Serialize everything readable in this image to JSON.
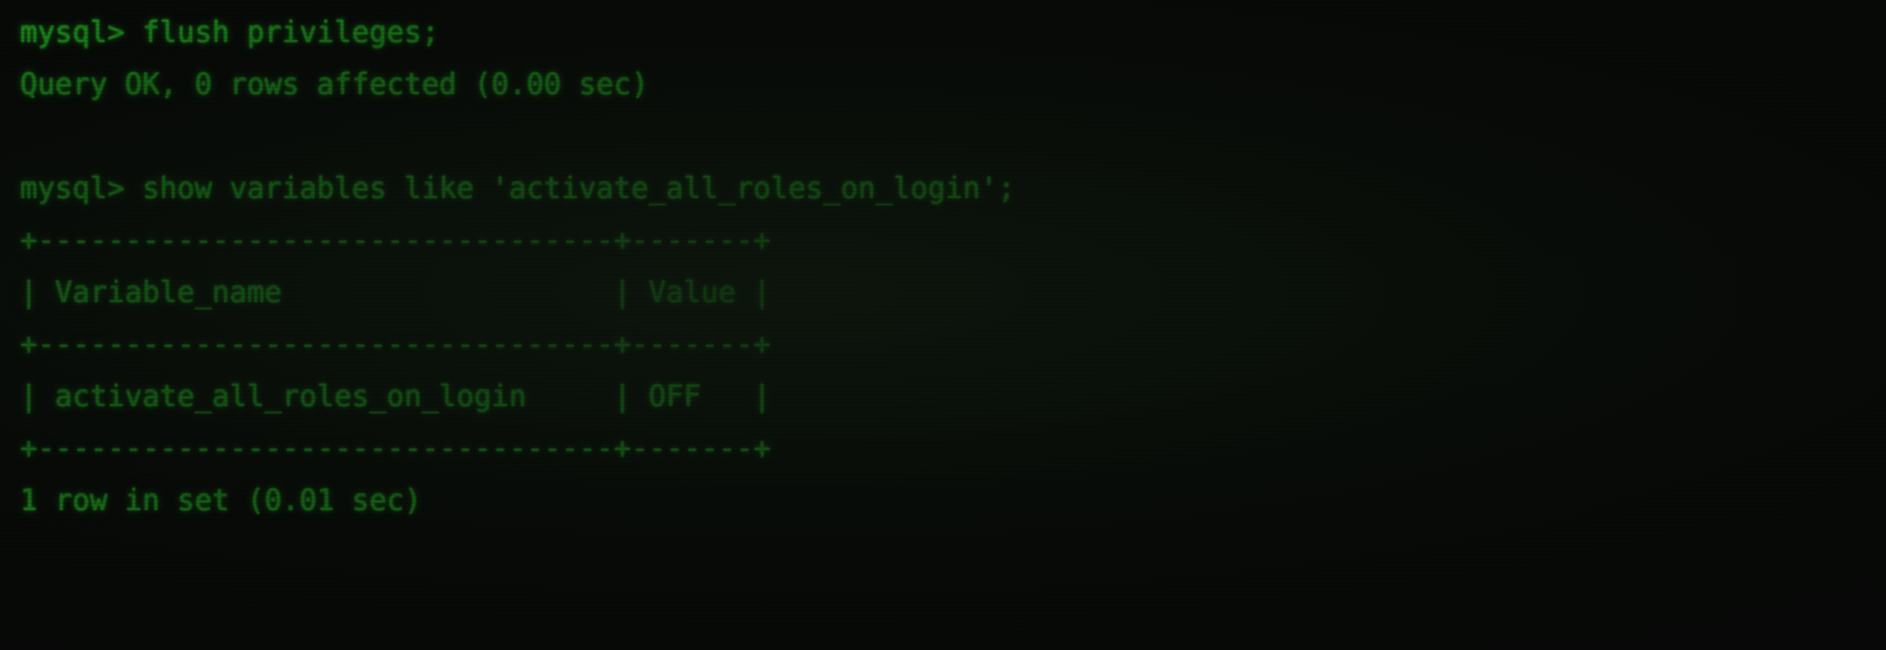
{
  "terminal": {
    "type": "mysql-client-console",
    "colors": {
      "background": "#070807",
      "foreground": "#24c924",
      "glow": "#3ceb3c"
    },
    "prompt": "mysql>",
    "lines": [
      {
        "id": "cmd-flush-privileges",
        "kind": "command",
        "text": "mysql> flush privileges;"
      },
      {
        "id": "result-flush-privileges",
        "kind": "result",
        "text": "Query OK, 0 rows affected (0.00 sec)"
      },
      {
        "id": "blank-1",
        "kind": "blank",
        "text": ""
      },
      {
        "id": "cmd-show-variables",
        "kind": "command",
        "text": "mysql> show variables like 'activate_all_roles_on_login';"
      },
      {
        "id": "table-border-top",
        "kind": "table-border",
        "text": "+---------------------------------+-------+"
      },
      {
        "id": "table-header-row",
        "kind": "table-header",
        "text": "| Variable_name                   | Value |"
      },
      {
        "id": "table-border-middle",
        "kind": "table-border",
        "text": "+---------------------------------+-------+"
      },
      {
        "id": "table-data-row-1",
        "kind": "table-row",
        "text": "| activate_all_roles_on_login     | OFF   |"
      },
      {
        "id": "table-border-bottom",
        "kind": "table-border",
        "text": "+---------------------------------+-------+"
      },
      {
        "id": "result-row-count",
        "kind": "result",
        "text": "1 row in set (0.01 sec)"
      }
    ],
    "commands": [
      {
        "text": "flush privileges;",
        "status": "Query OK",
        "rows_affected": 0,
        "duration": "0.00 sec"
      },
      {
        "text": "show variables like 'activate_all_roles_on_login';",
        "rows_returned": 1,
        "duration": "0.01 sec"
      }
    ],
    "result_table": {
      "columns": [
        "Variable_name",
        "Value"
      ],
      "rows": [
        {
          "Variable_name": "activate_all_roles_on_login",
          "Value": "OFF"
        }
      ],
      "footer": "1 row in set (0.01 sec)"
    }
  }
}
